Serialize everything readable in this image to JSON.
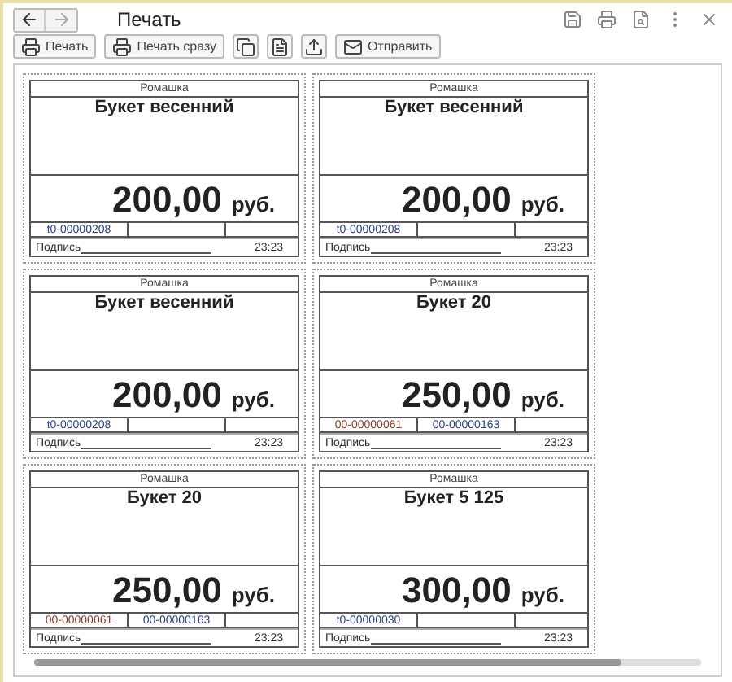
{
  "window": {
    "title": "Печать"
  },
  "toolbar": [
    {
      "kind": "print",
      "label": "Печать"
    },
    {
      "kind": "print",
      "label": "Печать сразу"
    },
    {
      "kind": "copy"
    },
    {
      "kind": "preview"
    },
    {
      "kind": "upload"
    },
    {
      "kind": "send",
      "label": "Отправить"
    }
  ],
  "labels": [
    {
      "shop": "Ромашка",
      "name": "Букет весенний",
      "price": "200,00",
      "currency": "руб.",
      "codes": [
        {
          "text": "t0-00000208",
          "color": "#2b3f86"
        }
      ],
      "signature": "Подпись",
      "time": "23:23"
    },
    {
      "shop": "Ромашка",
      "name": "Букет весенний",
      "price": "200,00",
      "currency": "руб.",
      "codes": [
        {
          "text": "t0-00000208",
          "color": "#2b3f86"
        }
      ],
      "signature": "Подпись",
      "time": "23:23"
    },
    {
      "shop": "Ромашка",
      "name": "Букет весенний",
      "price": "200,00",
      "currency": "руб.",
      "codes": [
        {
          "text": "t0-00000208",
          "color": "#2b3f86"
        }
      ],
      "signature": "Подпись",
      "time": "23:23"
    },
    {
      "shop": "Ромашка",
      "name": "Букет 20",
      "price": "250,00",
      "currency": "руб.",
      "codes": [
        {
          "text": "00-00000061",
          "color": "#8a3b2b"
        },
        {
          "text": "00-00000163",
          "color": "#2b3f86"
        }
      ],
      "signature": "Подпись",
      "time": "23:23"
    },
    {
      "shop": "Ромашка",
      "name": "Букет 20",
      "price": "250,00",
      "currency": "руб.",
      "codes": [
        {
          "text": "00-00000061",
          "color": "#8a3b2b"
        },
        {
          "text": "00-00000163",
          "color": "#2b3f86"
        }
      ],
      "signature": "Подпись",
      "time": "23:23"
    },
    {
      "shop": "Ромашка",
      "name": "Букет 5 125",
      "price": "300,00",
      "currency": "руб.",
      "codes": [
        {
          "text": "t0-00000030",
          "color": "#2b3f86"
        }
      ],
      "signature": "Подпись",
      "time": "23:23"
    }
  ]
}
